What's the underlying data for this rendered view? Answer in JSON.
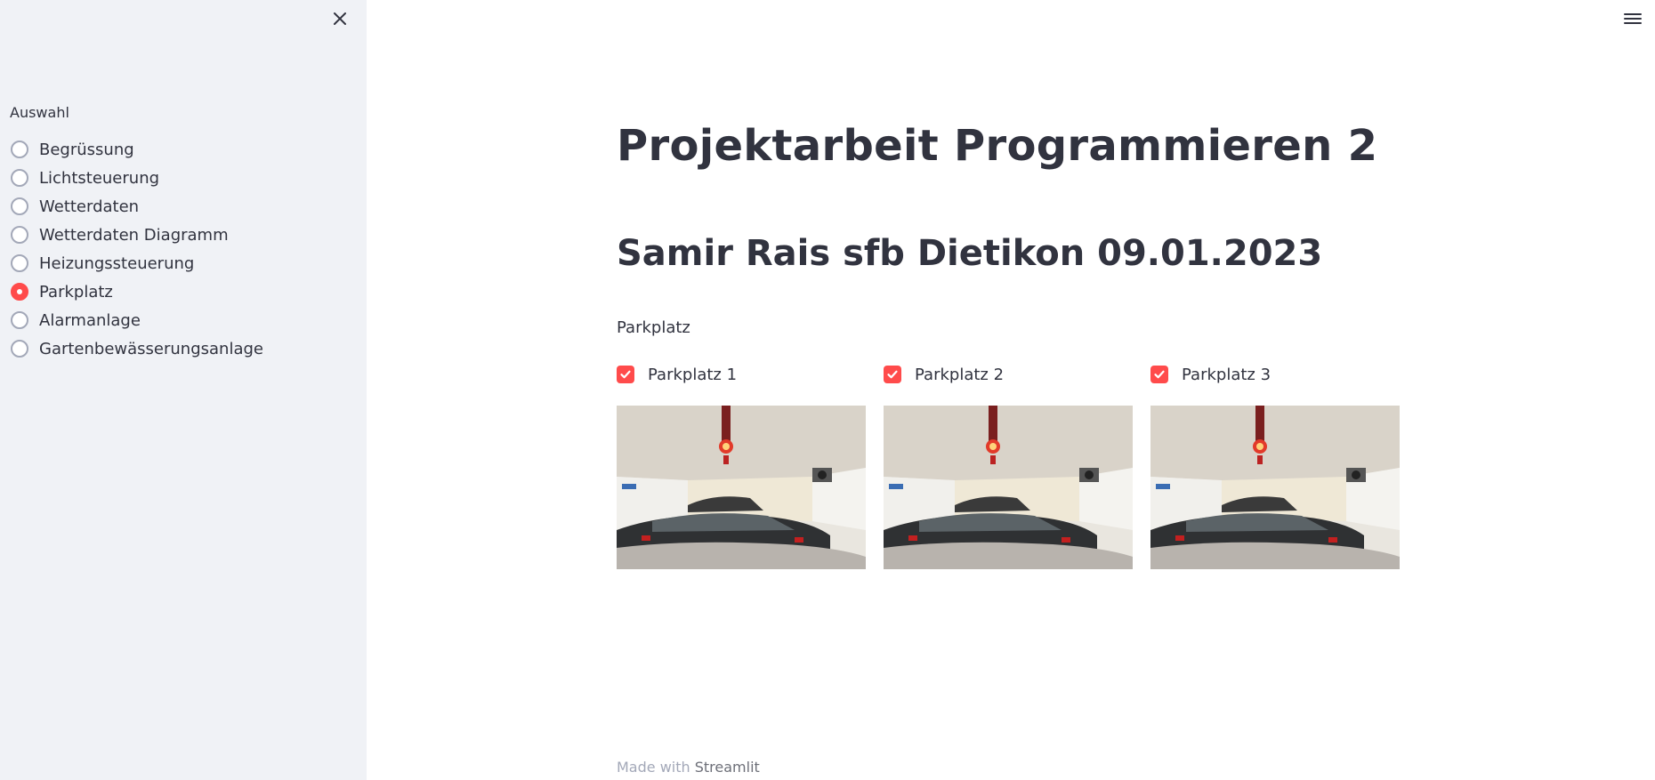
{
  "sidebar": {
    "label": "Auswahl",
    "items": [
      {
        "label": "Begrüssung",
        "selected": false
      },
      {
        "label": "Lichtsteuerung",
        "selected": false
      },
      {
        "label": "Wetterdaten",
        "selected": false
      },
      {
        "label": "Wetterdaten Diagramm",
        "selected": false
      },
      {
        "label": "Heizungssteuerung",
        "selected": false
      },
      {
        "label": "Parkplatz",
        "selected": true
      },
      {
        "label": "Alarmanlage",
        "selected": false
      },
      {
        "label": "Gartenbewässerungsanlage",
        "selected": false
      }
    ]
  },
  "main": {
    "title": "Projektarbeit Programmieren 2",
    "subtitle": "Samir Rais sfb Dietikon 09.01.2023",
    "section_label": "Parkplatz",
    "parking": [
      {
        "label": "Parkplatz 1",
        "checked": true
      },
      {
        "label": "Parkplatz 2",
        "checked": true
      },
      {
        "label": "Parkplatz 3",
        "checked": true
      }
    ]
  },
  "footer": {
    "prefix": "Made with",
    "brand": "Streamlit"
  },
  "colors": {
    "accent": "#ff4b4b",
    "sidebar_bg": "#f0f2f6",
    "text": "#31333f"
  },
  "icons": {
    "close": "close-icon",
    "menu": "hamburger-menu-icon",
    "check": "check-icon"
  }
}
